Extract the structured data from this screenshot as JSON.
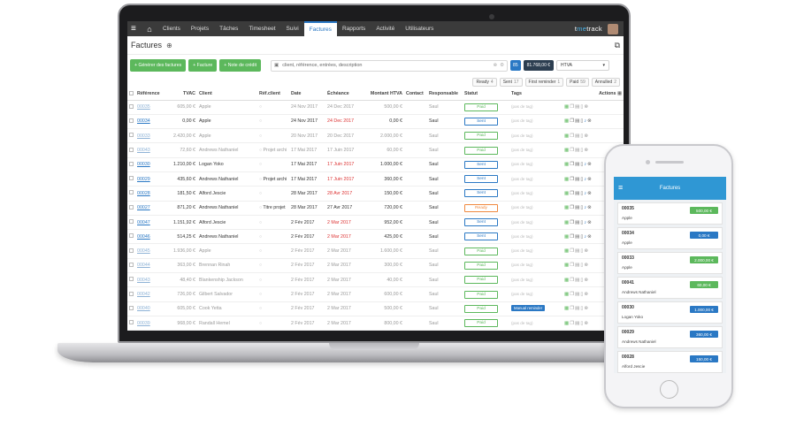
{
  "nav": {
    "items": [
      "Clients",
      "Projets",
      "Tâches",
      "Timesheet",
      "Suivi",
      "Factures",
      "Rapports",
      "Activité",
      "Utilisateurs"
    ],
    "active": "Factures",
    "brand_a": "t",
    "brand_b": "me",
    "brand_c": "track"
  },
  "page": {
    "title": "Factures"
  },
  "toolbar": {
    "btn_generate": "+ Générer des factures",
    "btn_invoice": "+ Facture",
    "btn_credit": "+ Note de crédit",
    "search_placeholder": "client, référence, entrées, description",
    "count_badge": "85",
    "total_badge": "81.768,00 €",
    "htva_select": "HTVA"
  },
  "filters": [
    {
      "label": "Ready",
      "count": "4"
    },
    {
      "label": "Sent",
      "count": "17"
    },
    {
      "label": "First reminder",
      "count": "1"
    },
    {
      "label": "Paid",
      "count": "59"
    },
    {
      "label": "Annulled",
      "count": "2"
    }
  ],
  "columns": [
    "Référence",
    "TVAC",
    "Client",
    "Réf.client",
    "Date",
    "Échéance",
    "Montant HTVA",
    "Contact",
    "Responsable",
    "Statut",
    "Tags",
    "Actions"
  ],
  "rows": [
    {
      "ref": "00035",
      "tvac": "605,00 €",
      "client": "Apple",
      "refclient": "",
      "date": "24 Nov 2017",
      "due": "24 Dec 2017",
      "late": false,
      "amount": "500,00 €",
      "resp": "Saul",
      "status": "Paid",
      "tag": "(pas de tag)",
      "grey": true
    },
    {
      "ref": "00034",
      "tvac": "0,00 €",
      "client": "Apple",
      "refclient": "",
      "date": "24 Nov 2017",
      "due": "24 Dec 2017",
      "late": true,
      "amount": "0,00 €",
      "resp": "Saul",
      "status": "Sent",
      "tag": "(pas de tag)",
      "grey": false
    },
    {
      "ref": "00033",
      "tvac": "2.420,00 €",
      "client": "Apple",
      "refclient": "",
      "date": "20 Nov 2017",
      "due": "20 Dec 2017",
      "late": false,
      "amount": "2.000,00 €",
      "resp": "Saul",
      "status": "Paid",
      "tag": "(pas de tag)",
      "grey": true
    },
    {
      "ref": "00043",
      "tvac": "72,60 €",
      "client": "Andrews Nathaniel",
      "refclient": "Projet archi",
      "date": "17 Mai 2017",
      "due": "17 Juin 2017",
      "late": false,
      "amount": "60,00 €",
      "resp": "Saul",
      "status": "Paid",
      "tag": "(pas de tag)",
      "grey": true
    },
    {
      "ref": "00030",
      "tvac": "1.210,00 €",
      "client": "Logan Yoko",
      "refclient": "",
      "date": "17 Mai 2017",
      "due": "17 Juin 2017",
      "late": true,
      "amount": "1.000,00 €",
      "resp": "Saul",
      "status": "Sent",
      "tag": "(pas de tag)",
      "grey": false
    },
    {
      "ref": "00029",
      "tvac": "435,60 €",
      "client": "Andrews Nathaniel",
      "refclient": "Projet archi",
      "date": "17 Mai 2017",
      "due": "17 Juin 2017",
      "late": true,
      "amount": "360,00 €",
      "resp": "Saul",
      "status": "Sent",
      "tag": "(pas de tag)",
      "grey": false
    },
    {
      "ref": "00028",
      "tvac": "181,50 €",
      "client": "Alford Jescie",
      "refclient": "",
      "date": "28 Mar 2017",
      "due": "28 Avr 2017",
      "late": true,
      "amount": "150,00 €",
      "resp": "Saul",
      "status": "Sent",
      "tag": "(pas de tag)",
      "grey": false
    },
    {
      "ref": "00027",
      "tvac": "871,20 €",
      "client": "Andrews Nathaniel",
      "refclient": "Titre projet",
      "date": "28 Mar 2017",
      "due": "27 Avr 2017",
      "late": false,
      "amount": "720,00 €",
      "resp": "Saul",
      "status": "Ready",
      "tag": "(pas de tag)",
      "grey": false
    },
    {
      "ref": "00047",
      "tvac": "1.151,92 €",
      "client": "Alford Jescie",
      "refclient": "",
      "date": "2 Fév 2017",
      "due": "2 Mar 2017",
      "late": true,
      "amount": "952,00 €",
      "resp": "Saul",
      "status": "Sent",
      "tag": "(pas de tag)",
      "grey": false
    },
    {
      "ref": "00046",
      "tvac": "514,25 €",
      "client": "Andrews Nathaniel",
      "refclient": "",
      "date": "2 Fév 2017",
      "due": "2 Mar 2017",
      "late": true,
      "amount": "425,00 €",
      "resp": "Saul",
      "status": "Sent",
      "tag": "(pas de tag)",
      "grey": false
    },
    {
      "ref": "00045",
      "tvac": "1.936,00 €",
      "client": "Apple",
      "refclient": "",
      "date": "2 Fév 2017",
      "due": "2 Mar 2017",
      "late": false,
      "amount": "1.600,00 €",
      "resp": "Saul",
      "status": "Paid",
      "tag": "(pas de tag)",
      "grey": true
    },
    {
      "ref": "00044",
      "tvac": "363,00 €",
      "client": "Brennan Rinah",
      "refclient": "",
      "date": "2 Fév 2017",
      "due": "2 Mar 2017",
      "late": false,
      "amount": "300,00 €",
      "resp": "Saul",
      "status": "Paid",
      "tag": "(pas de tag)",
      "grey": true
    },
    {
      "ref": "00043",
      "tvac": "48,40 €",
      "client": "Blankenship Jackson",
      "refclient": "",
      "date": "2 Fév 2017",
      "due": "2 Mar 2017",
      "late": false,
      "amount": "40,00 €",
      "resp": "Saul",
      "status": "Paid",
      "tag": "(pas de tag)",
      "grey": true
    },
    {
      "ref": "00042",
      "tvac": "726,00 €",
      "client": "Gilbert Salvador",
      "refclient": "",
      "date": "2 Fév 2017",
      "due": "2 Mar 2017",
      "late": false,
      "amount": "600,00 €",
      "resp": "Saul",
      "status": "Paid",
      "tag": "(pas de tag)",
      "grey": true
    },
    {
      "ref": "00040",
      "tvac": "605,00 €",
      "client": "Cook Yetta",
      "refclient": "",
      "date": "2 Fév 2017",
      "due": "2 Mar 2017",
      "late": false,
      "amount": "500,00 €",
      "resp": "Saul",
      "status": "Paid",
      "tag": "Manual reminder",
      "grey": true
    },
    {
      "ref": "00039",
      "tvac": "968,00 €",
      "client": "Randall Hemel",
      "refclient": "",
      "date": "2 Fév 2017",
      "due": "2 Mar 2017",
      "late": false,
      "amount": "800,00 €",
      "resp": "Saul",
      "status": "Paid",
      "tag": "(pas de tag)",
      "grey": true
    }
  ],
  "phone": {
    "title": "Factures",
    "cards": [
      {
        "ref": "00035",
        "client": "Apple",
        "amount": "500,00 €",
        "status": "paid"
      },
      {
        "ref": "00034",
        "client": "Apple",
        "amount": "0,00 €",
        "status": "sent"
      },
      {
        "ref": "00033",
        "client": "Apple",
        "amount": "2.000,00 €",
        "status": "paid"
      },
      {
        "ref": "00041",
        "client": "Andrews Nathaniel",
        "amount": "60,00 €",
        "status": "paid"
      },
      {
        "ref": "00030",
        "client": "Logan Yoko",
        "amount": "1.000,00 €",
        "status": "sent"
      },
      {
        "ref": "00029",
        "client": "Andrews Nathaniel",
        "amount": "360,00 €",
        "status": "sent"
      },
      {
        "ref": "00028",
        "client": "Alford Jescie",
        "amount": "150,00 €",
        "status": "sent"
      }
    ]
  },
  "colors": {
    "accent": "#2a78c4",
    "paid": "#5cb85c",
    "ready": "#f0883e",
    "phone_header": "#2f97d4"
  }
}
